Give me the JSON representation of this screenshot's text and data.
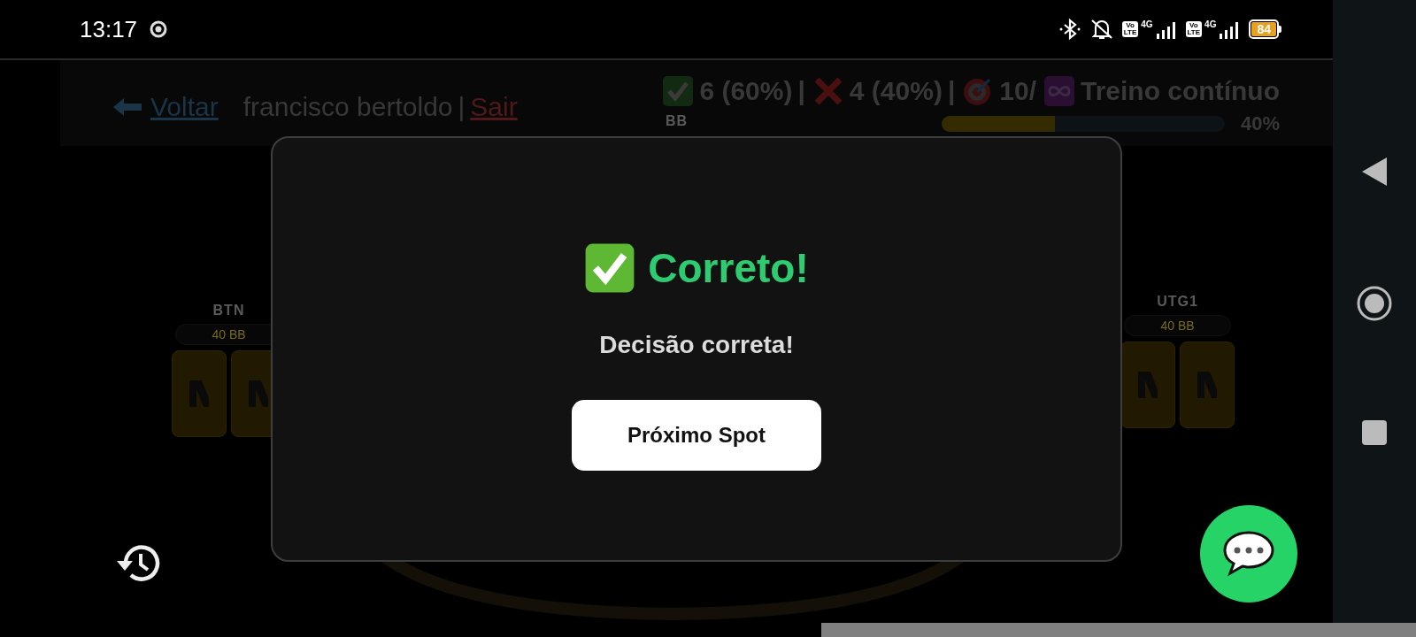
{
  "status_bar": {
    "time": "13:17",
    "sims": [
      {
        "volte_top": "Vo",
        "volte_bottom": "LTE",
        "network": "4G"
      },
      {
        "volte_top": "Vo",
        "volte_bottom": "LTE",
        "network": "4G"
      }
    ],
    "battery": "84"
  },
  "header": {
    "back_link": "Voltar",
    "user": "francisco bertoldo",
    "separator": "|",
    "logout_link": "Sair",
    "stats": [
      {
        "kind": "correct",
        "text": "6 (60%)",
        "separator": "|"
      },
      {
        "kind": "wrong",
        "text": "4 (40%)",
        "separator": "|"
      },
      {
        "kind": "target",
        "text": "10/"
      },
      {
        "kind": "infinite",
        "text": "Treino contínuo"
      }
    ],
    "progress": {
      "level": 0.4,
      "reading": "40%"
    }
  },
  "table": {
    "seats": [
      {
        "position": "BB"
      },
      {
        "position": "BTN",
        "stack": "40 BB"
      },
      {
        "position": "UTG1",
        "stack": "40 BB"
      }
    ]
  },
  "dialog": {
    "title": "Correto!",
    "message": "Decisão correta!",
    "button": "Próximo Spot"
  }
}
